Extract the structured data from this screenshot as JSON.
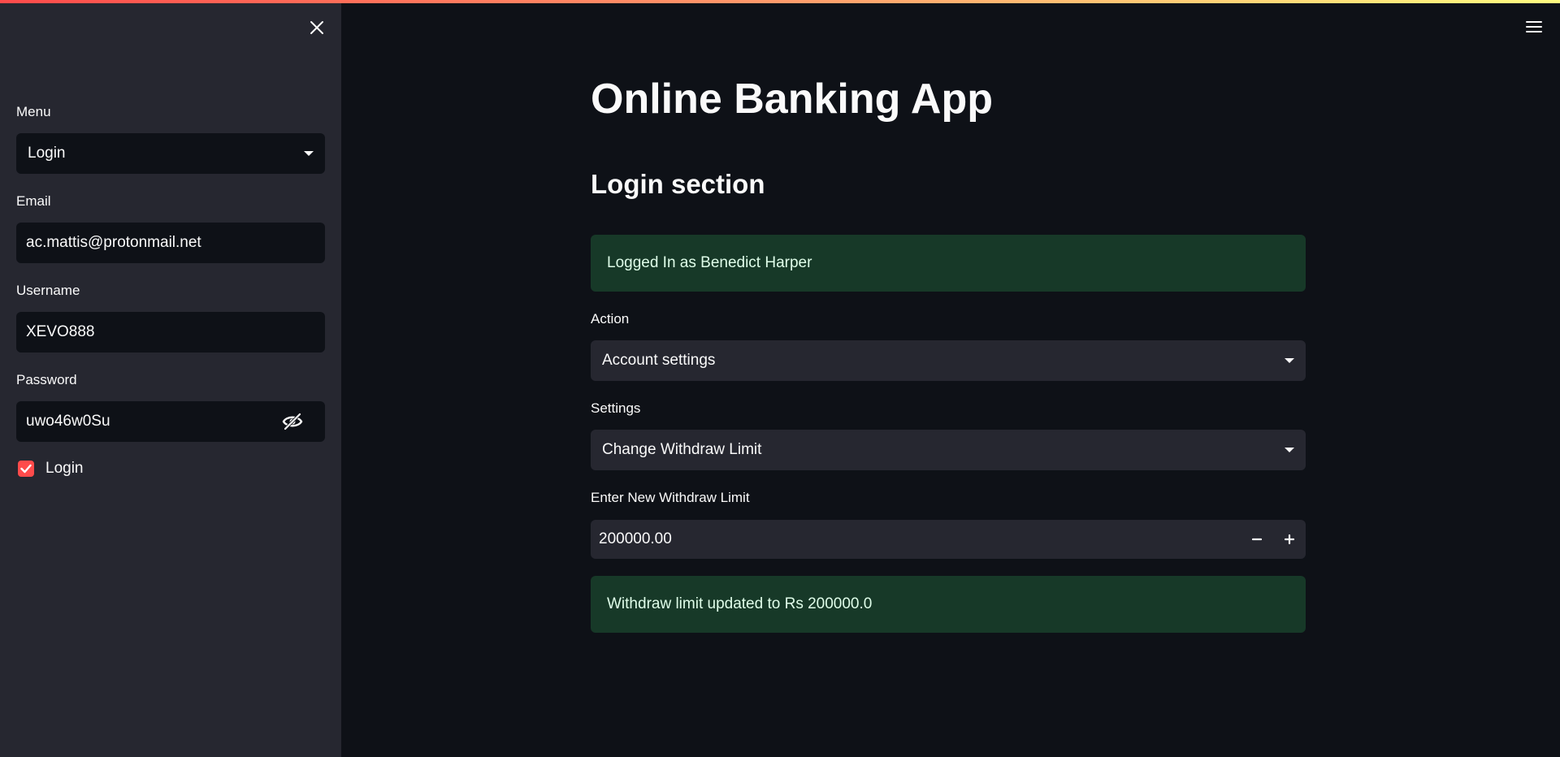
{
  "sidebar": {
    "menu_label": "Menu",
    "menu_value": "Login",
    "email_label": "Email",
    "email_value": "ac.mattis@protonmail.net",
    "username_label": "Username",
    "username_value": "XEVO888",
    "password_label": "Password",
    "password_value": "uwo46w0Su",
    "login_checkbox_label": "Login",
    "login_checked": true
  },
  "main": {
    "title": "Online Banking App",
    "section_title": "Login section",
    "logged_in_message": "Logged In as Benedict Harper",
    "action_label": "Action",
    "action_value": "Account settings",
    "settings_label": "Settings",
    "settings_value": "Change Withdraw Limit",
    "limit_label": "Enter New Withdraw Limit",
    "limit_value": "200000.00",
    "success_message": "Withdraw limit updated to Rs 200000.0"
  },
  "colors": {
    "background": "#0e1117",
    "sidebar": "#262730",
    "accent": "#ff4b4b",
    "success_bg": "#173928",
    "success_text": "#dffde9"
  },
  "icons": {
    "close": "close-icon",
    "menu": "hamburger-menu-icon",
    "dropdown": "caret-down-icon",
    "password_toggle": "eye-slash-icon",
    "checkbox": "checkmark-icon",
    "decrement": "minus-icon",
    "increment": "plus-icon"
  }
}
